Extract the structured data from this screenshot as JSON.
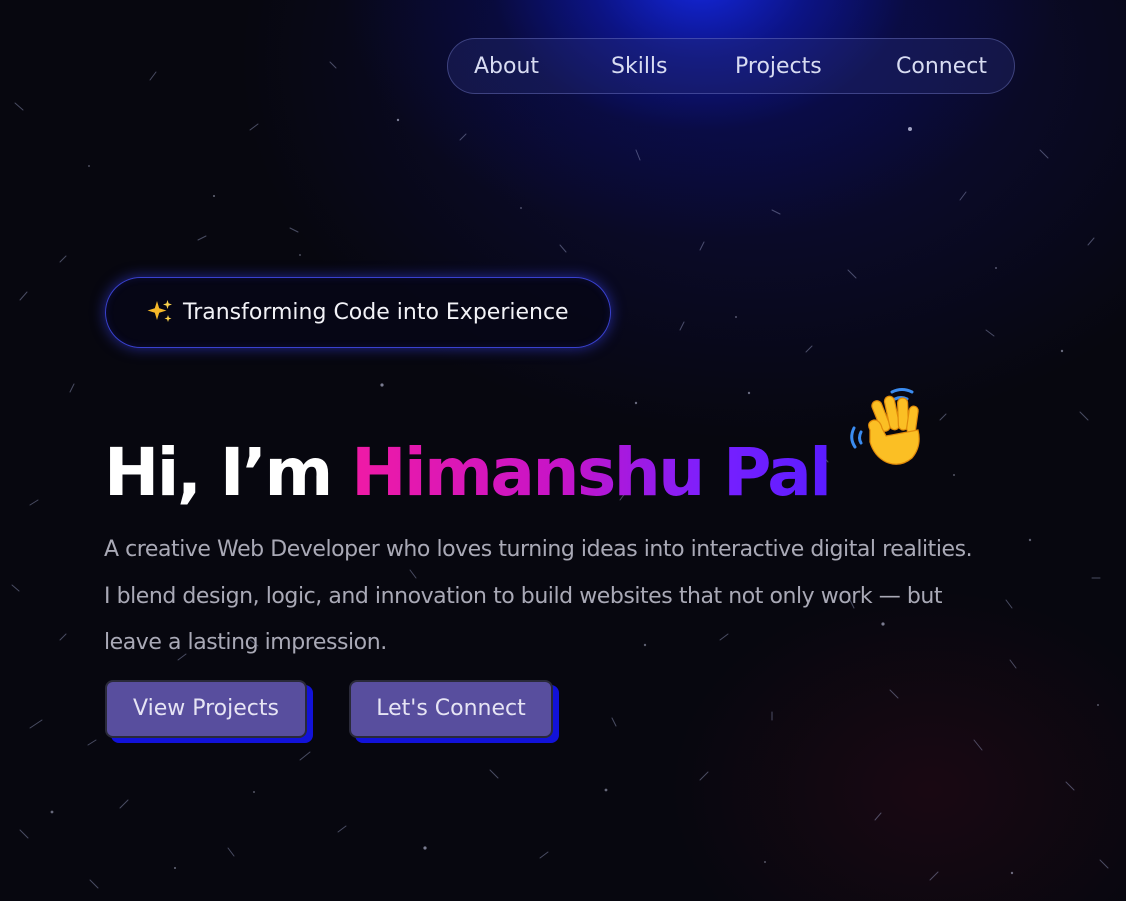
{
  "nav": {
    "items": [
      {
        "label": "About"
      },
      {
        "label": "Skills"
      },
      {
        "label": "Projects"
      },
      {
        "label": "Connect"
      }
    ]
  },
  "hero": {
    "tagline": "Transforming Code into Experience",
    "tagline_icon": "sparkles-icon",
    "greeting": "Hi, I’m ",
    "name": "Himanshu Pal",
    "wave_icon": "waving-hand-icon",
    "description_lines": [
      "A creative Web Developer who loves turning ideas into interactive digital realities.",
      "I blend design, logic, and innovation to build websites that not only work — but",
      "leave a lasting impression."
    ],
    "buttons": {
      "view_projects": "View Projects",
      "lets_connect": "Let's Connect"
    }
  },
  "colors": {
    "background": "#07070f",
    "glow": "#1428e6",
    "name_gradient_start": "#f01aa5",
    "name_gradient_end": "#5a1cff",
    "button_fill": "#584e9e",
    "button_shadow": "#1212d8",
    "pill_border": "#4650ff"
  }
}
